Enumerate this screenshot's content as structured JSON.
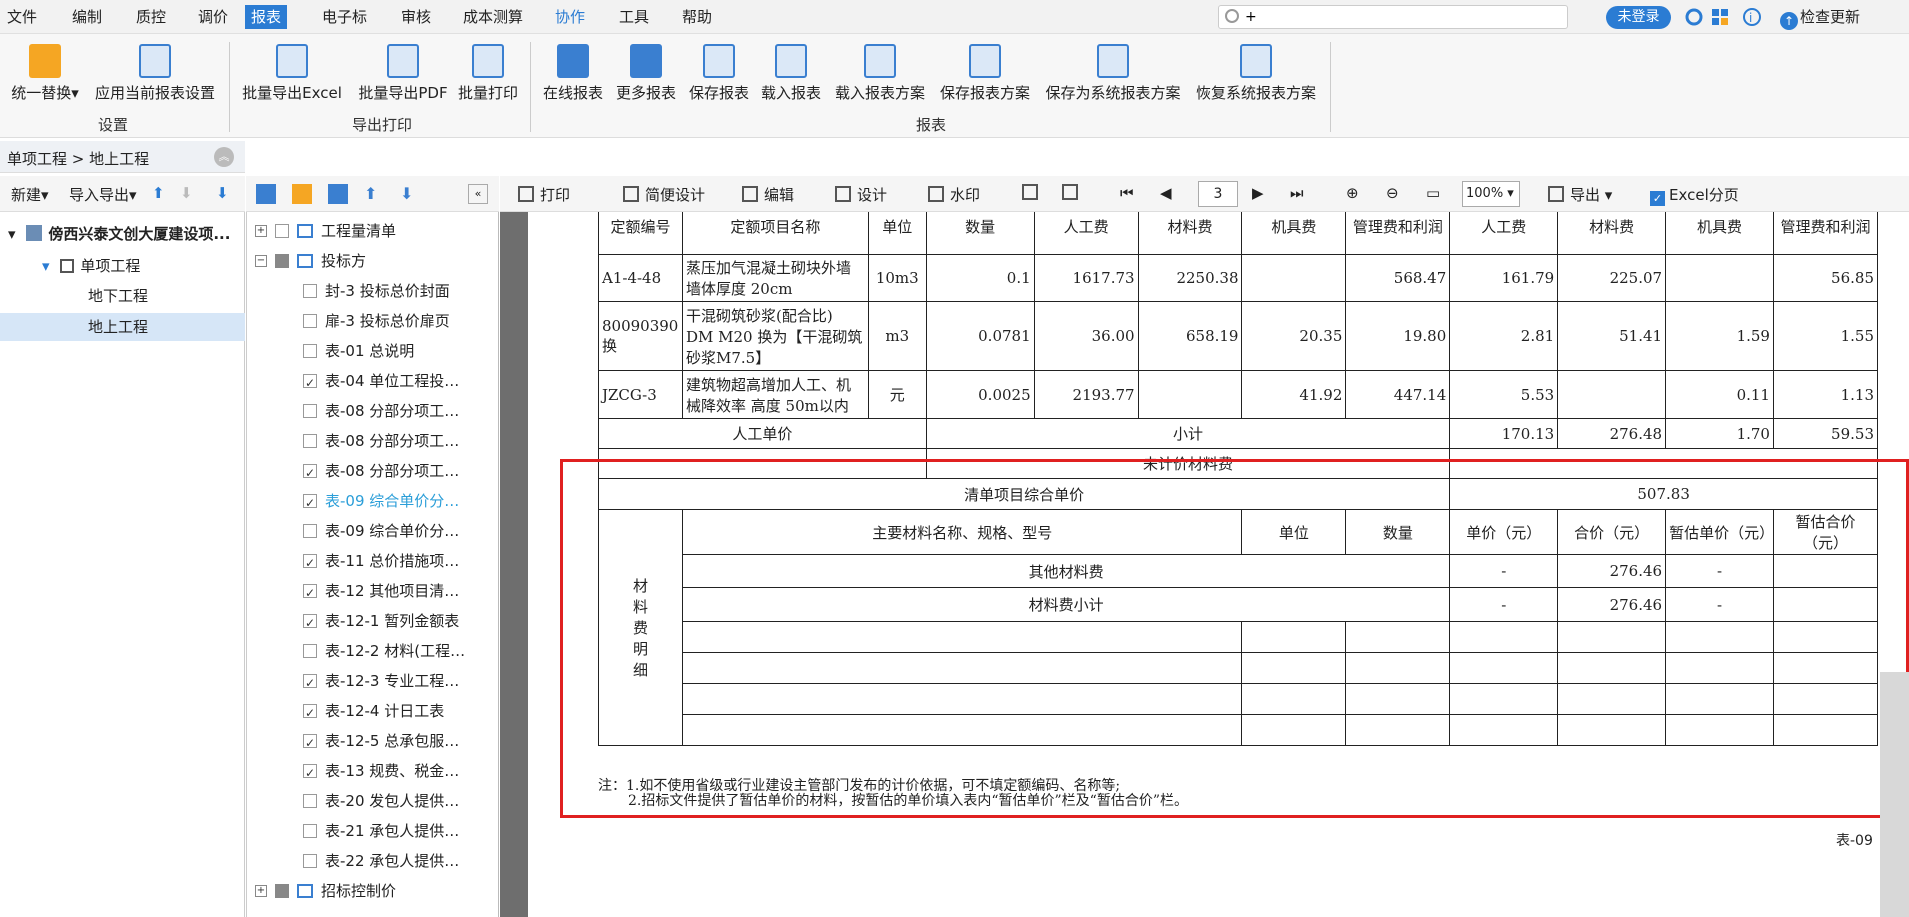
{
  "menu": [
    "文件",
    "编制",
    "质控",
    "调价",
    "报表",
    "电子标",
    "审核",
    "成本测算",
    "协作",
    "工具",
    "帮助"
  ],
  "search": {
    "value": "+"
  },
  "login": "未登录",
  "update": "检查更新",
  "ribbon": {
    "buttons": [
      "统一替换",
      "应用当前报表设置",
      "批量导出Excel",
      "批量导出PDF",
      "批量打印",
      "在线报表",
      "更多报表",
      "保存报表",
      "载入报表",
      "载入报表方案",
      "保存报表方案",
      "保存为系统报表方案",
      "恢复系统报表方案"
    ],
    "groups": [
      "设置",
      "导出打印",
      "报表"
    ]
  },
  "breadcrumb": "单项工程 > 地上工程",
  "left_toolbar": {
    "new": "新建",
    "import": "导入导出"
  },
  "left_tree": [
    "傍西兴泰文创大厦建设项...",
    "单项工程",
    "地下工程",
    "地上工程"
  ],
  "mid_tree": [
    {
      "label": "工程量清单",
      "check": false
    },
    {
      "label": "投标方",
      "check": false
    },
    {
      "label": "封-3 投标总价封面",
      "check": false
    },
    {
      "label": "扉-3 投标总价扉页",
      "check": false
    },
    {
      "label": "表-01 总说明",
      "check": false
    },
    {
      "label": "表-04 单位工程投…",
      "check": true
    },
    {
      "label": "表-08 分部分项工…",
      "check": false
    },
    {
      "label": "表-08 分部分项工…",
      "check": false
    },
    {
      "label": "表-08 分部分项工…",
      "check": true
    },
    {
      "label": "表-09 综合单价分…",
      "check": true
    },
    {
      "label": "表-09 综合单价分…",
      "check": false
    },
    {
      "label": "表-11 总价措施项…",
      "check": true
    },
    {
      "label": "表-12 其他项目清…",
      "check": true
    },
    {
      "label": "表-12-1 暂列金额表",
      "check": true
    },
    {
      "label": "表-12-2 材料(工程…",
      "check": false
    },
    {
      "label": "表-12-3 专业工程…",
      "check": true
    },
    {
      "label": "表-12-4 计日工表",
      "check": true
    },
    {
      "label": "表-12-5 总承包服…",
      "check": true
    },
    {
      "label": "表-13 规费、税金…",
      "check": true
    },
    {
      "label": "表-20 发包人提供…",
      "check": false
    },
    {
      "label": "表-21 承包人提供…",
      "check": false
    },
    {
      "label": "表-22 承包人提供…",
      "check": false
    },
    {
      "label": "招标控制价",
      "check": false
    }
  ],
  "report_toolbar": {
    "print": "打印",
    "simple": "简便设计",
    "edit": "编辑",
    "design": "设计",
    "watermark": "水印",
    "page": "3",
    "zoom": "100%",
    "export": "导出",
    "excel_split": "Excel分页"
  },
  "report": {
    "header": {
      "code": "定额编号",
      "name": "定额项目名称",
      "unit": "单位",
      "qty": "数量",
      "labor": "人工费",
      "material": "材料费",
      "machine": "机具费",
      "mgmt": "管理费和利润"
    },
    "rows": [
      {
        "code": "A1-4-48",
        "name": "蒸压加气混凝土砌块外墙 墙体厚度 20cm",
        "unit": "10m3",
        "qty": "0.1",
        "p1": "1617.73",
        "p2": "2250.38",
        "p3": "",
        "p4": "568.47",
        "t1": "161.79",
        "t2": "225.07",
        "t3": "",
        "t4": "56.85"
      },
      {
        "code": "80090390换",
        "name": "干混砌筑砂浆(配合比) DM M20 换为【干混砌筑砂浆M7.5】",
        "unit": "m3",
        "qty": "0.0781",
        "p1": "36.00",
        "p2": "658.19",
        "p3": "20.35",
        "p4": "19.80",
        "t1": "2.81",
        "t2": "51.41",
        "t3": "1.59",
        "t4": "1.55"
      },
      {
        "code": "JZCG-3",
        "name": "建筑物超高增加人工、机械降效率 高度 50m以内",
        "unit": "元",
        "qty": "0.0025",
        "p1": "2193.77",
        "p2": "",
        "p3": "41.92",
        "p4": "447.14",
        "t1": "5.53",
        "t2": "",
        "t3": "0.11",
        "t4": "1.13"
      }
    ],
    "labor_price": "人工单价",
    "subtotal": "小计",
    "subtotal_vals": [
      "170.13",
      "276.48",
      "1.70",
      "59.53"
    ],
    "unpriced": "未计价材料费",
    "unit_price_label": "清单项目综合单价",
    "unit_price": "507.83",
    "mat_title": "材料费明细",
    "mat_header": {
      "name": "主要材料名称、规格、型号",
      "unit": "单位",
      "qty": "数量",
      "price": "单价（元）",
      "total": "合价（元）",
      "est_price": "暂估单价（元）",
      "est_total": "暂估合价（元）"
    },
    "other_mat": "其他材料费",
    "mat_subtotal": "材料费小计",
    "dash": "-",
    "other_total": "276.46",
    "mat_total": "276.46",
    "note1": "注：1.如不使用省级或行业建设主管部门发布的计价依据，可不填定额编码、名称等;",
    "note2": "2.招标文件提供了暂估单价的材料，按暂估的单价填入表内“暂估单价”栏及“暂估合价”栏。",
    "table_no": "表-09"
  },
  "colors": {
    "accent": "#2b7cd3",
    "highlight": "#e02020"
  }
}
